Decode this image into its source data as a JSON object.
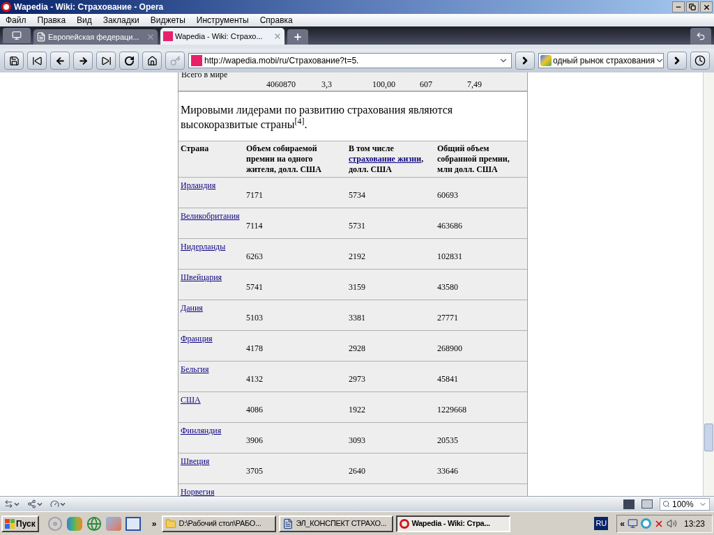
{
  "window": {
    "title": "Wapedia - Wiki: Страхование - Opera"
  },
  "menu": [
    "Файл",
    "Правка",
    "Вид",
    "Закладки",
    "Виджеты",
    "Инструменты",
    "Справка"
  ],
  "tabs": [
    {
      "label": "Европейская федераци...",
      "selected": false
    },
    {
      "label": "Wapedia - Wiki: Страхо...",
      "selected": true
    }
  ],
  "address": {
    "value": "http://wapedia.mobi/ru/Страхование?t=5."
  },
  "search": {
    "value": "одный рынок страхования"
  },
  "page": {
    "prev_row": {
      "label": "Всего в мире",
      "cells": [
        "4060870",
        "3,3",
        "100,00",
        "607",
        "7,49"
      ]
    },
    "paragraph": "Мировыми лидерами по развитию страхования являются высокоразвитые страны$^{[4]}$.",
    "table": {
      "columns": [
        {
          "text": "Страна"
        },
        {
          "text": "Объем собираемой премии на одного жителя, долл. США"
        },
        {
          "before": "В том числе",
          "link": "страхование жизни",
          "after": ", долл. США"
        },
        {
          "text": "Общий объем собранной премии, млн долл. США"
        }
      ],
      "rows": [
        {
          "cells": [
            "Ирландия",
            "7171",
            "5734",
            "60693"
          ]
        },
        {
          "cells": [
            "Великобритания",
            "7114",
            "5731",
            "463686"
          ]
        },
        {
          "cells": [
            "Нидерланды",
            "6263",
            "2192",
            "102831"
          ]
        },
        {
          "cells": [
            "Швейцария",
            "5741",
            "3159",
            "43580"
          ]
        },
        {
          "cells": [
            "Дания",
            "5103",
            "3381",
            "27771"
          ]
        },
        {
          "cells": [
            "Франция",
            "4178",
            "2928",
            "268900"
          ]
        },
        {
          "cells": [
            "Бельгия",
            "4132",
            "2973",
            "45841"
          ]
        },
        {
          "cells": [
            "США",
            "4086",
            "1922",
            "1229668"
          ]
        },
        {
          "cells": [
            "Финляндия",
            "3906",
            "3093",
            "20535"
          ]
        },
        {
          "cells": [
            "Швеция",
            "3705",
            "2640",
            "33646"
          ]
        }
      ],
      "cut_row": "Норвегия"
    }
  },
  "status_bar": {
    "zoom": "100%"
  },
  "taskbar": {
    "start": "Пуск",
    "more": "»",
    "items": [
      {
        "label": "D:\\Рабочий стол\\РАБО...",
        "kind": "folder",
        "selected": false
      },
      {
        "label": "ЭЛ_КОНСПЕКТ СТРАХО...",
        "kind": "word",
        "selected": false
      },
      {
        "label": "Wapedia - Wiki: Стра...",
        "kind": "opera",
        "selected": true
      }
    ],
    "language": "RU",
    "tray_toggle": "«",
    "time": "13:23"
  }
}
